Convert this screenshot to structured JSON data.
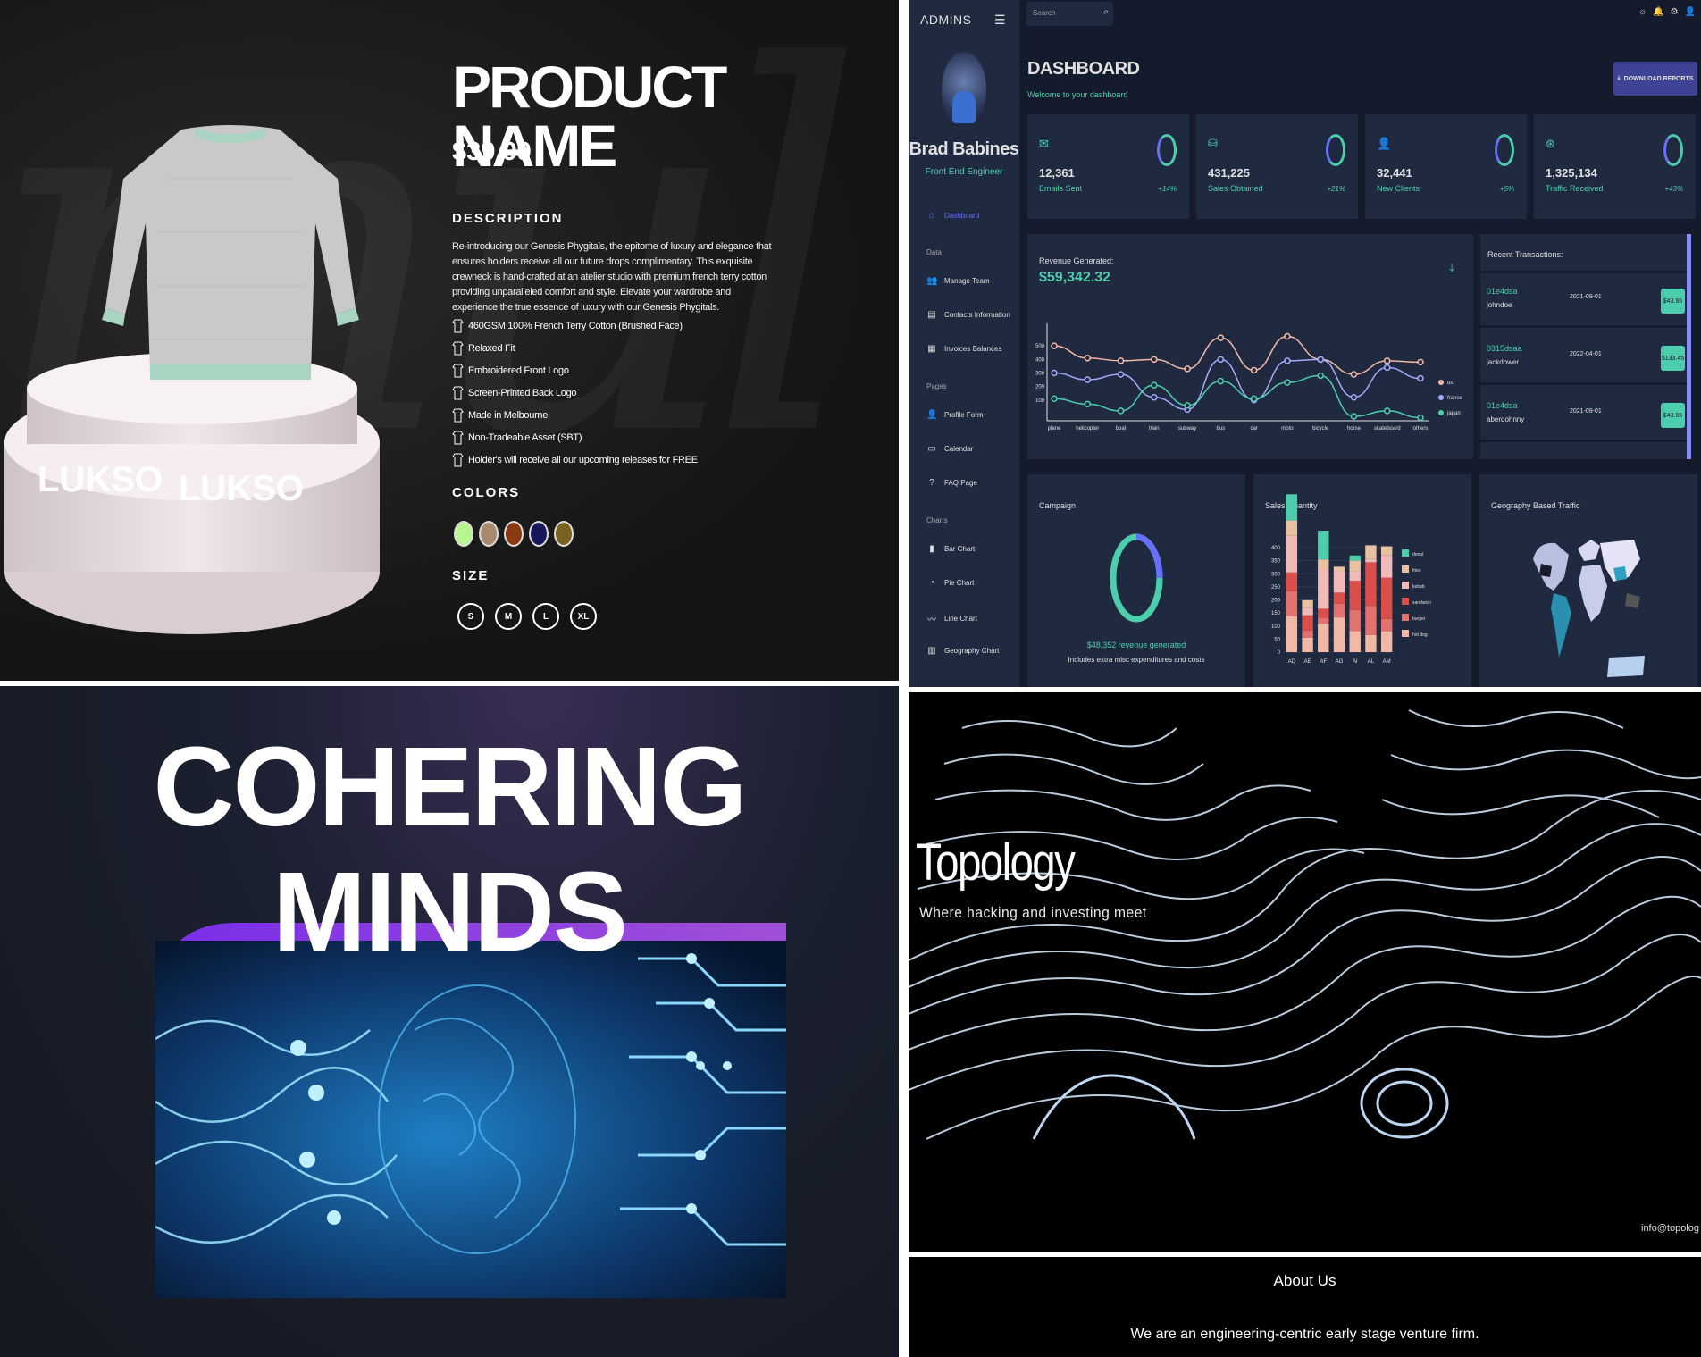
{
  "product": {
    "title": "PRODUCT NAME",
    "price": "$39.99",
    "description_label": "DESCRIPTION",
    "description": "Re-introducing our Genesis Phygitals, the epitome of luxury and elegance that ensures holders receive all our future drops complimentary. This exquisite crewneck is hand-crafted at an atelier studio with premium french terry cotton providing unparalleled comfort and style. Elevate your wardrobe and experience the true essence of luxury with our Genesis Phygitals.",
    "features": [
      "460GSM 100% French Terry Cotton (Brushed Face)",
      "Relaxed Fit",
      "Embroidered Front Logo",
      "Screen-Printed Back Logo",
      "Made in Melbourne",
      "Non-Tradeable Asset (SBT)",
      "Holder's will receive all our upcoming releases for FREE"
    ],
    "colors_label": "COLORS",
    "colors": [
      "#b7f58f",
      "#a8896e",
      "#8a3a10",
      "#17175a",
      "#7a6220"
    ],
    "size_label": "SIZE",
    "sizes": [
      "S",
      "M",
      "L",
      "XL"
    ],
    "pedestal_brand": "LUKSO"
  },
  "dashboard": {
    "brand": "ADMINS",
    "user_name": "Brad Babines",
    "user_role": "Front End Engineer",
    "nav": {
      "dashboard": "Dashboard",
      "section_data": "Data",
      "manage_team": "Manage Team",
      "contacts": "Contacts Information",
      "invoices": "Invoices Balances",
      "section_pages": "Pages",
      "profile": "Profile Form",
      "calendar": "Calendar",
      "faq": "FAQ Page",
      "section_charts": "Charts",
      "bar": "Bar Chart",
      "pie": "Pie Chart",
      "line": "Line Chart",
      "geo": "Geography Chart"
    },
    "search_placeholder": "Search",
    "title": "DASHBOARD",
    "subtitle": "Welcome to your dashboard",
    "download_label": "DOWNLOAD REPORTS",
    "stats": [
      {
        "value": "12,361",
        "label": "Emails Sent",
        "change": "+14%",
        "progress": 0.75
      },
      {
        "value": "431,225",
        "label": "Sales Obtained",
        "change": "+21%",
        "progress": 0.5
      },
      {
        "value": "32,441",
        "label": "New Clients",
        "change": "+5%",
        "progress": 0.3
      },
      {
        "value": "1,325,134",
        "label": "Traffic Received",
        "change": "+43%",
        "progress": 0.8
      }
    ],
    "revenue_label": "Revenue Generated:",
    "revenue_value": "$59,342.32",
    "transactions_label": "Recent Transactions:",
    "transactions": [
      {
        "id": "01e4dsa",
        "user": "johndoe",
        "date": "2021-09-01",
        "cost": "$43.95"
      },
      {
        "id": "0315dsaa",
        "user": "jackdower",
        "date": "2022-04-01",
        "cost": "$133.45"
      },
      {
        "id": "01e4dsa",
        "user": "aberdohnny",
        "date": "2021-09-01",
        "cost": "$43.95"
      }
    ],
    "campaign_label": "Campaign",
    "campaign_revenue": "$48,352 revenue generated",
    "campaign_note": "Includes extra misc expenditures and costs",
    "sales_label": "Sales Quantity",
    "geo_label": "Geography Based Traffic"
  },
  "chart_data": [
    {
      "type": "line",
      "categories": [
        "plane",
        "helicopter",
        "boat",
        "train",
        "subway",
        "bus",
        "car",
        "moto",
        "bicycle",
        "horse",
        "skateboard",
        "others"
      ],
      "series": [
        {
          "name": "us",
          "color": "#f2b8a6",
          "values": [
            500,
            410,
            390,
            400,
            330,
            560,
            320,
            570,
            400,
            290,
            390,
            380
          ]
        },
        {
          "name": "france",
          "color": "#a4a9fc",
          "values": [
            300,
            250,
            290,
            120,
            30,
            400,
            100,
            390,
            400,
            120,
            340,
            260
          ]
        },
        {
          "name": "japan",
          "color": "#4cceac",
          "values": [
            110,
            70,
            20,
            210,
            60,
            240,
            110,
            230,
            280,
            -20,
            20,
            -30
          ]
        }
      ],
      "yticks": [
        100,
        200,
        300,
        400,
        500
      ],
      "ylim": [
        -40,
        600
      ],
      "legend": "right"
    },
    {
      "type": "bar",
      "categories": [
        "AD",
        "AE",
        "AF",
        "AG",
        "AI",
        "AL",
        "AM"
      ],
      "series": [
        {
          "name": "hot dog",
          "color": "#f2b8a6",
          "values": [
            137,
            55,
            109,
            133,
            81,
            66,
            80
          ]
        },
        {
          "name": "burger",
          "color": "#e2726e",
          "values": [
            96,
            28,
            23,
            52,
            80,
            111,
            47
          ]
        },
        {
          "name": "sandwich",
          "color": "#db4f4a",
          "values": [
            72,
            58,
            34,
            43,
            112,
            167,
            158
          ]
        },
        {
          "name": "kebab",
          "color": "#f1b9b7",
          "values": [
            140,
            29,
            152,
            83,
            35,
            14,
            85
          ]
        },
        {
          "name": "fries",
          "color": "#e8c1a0",
          "values": [
            59,
            29,
            37,
            16,
            42,
            51,
            35
          ]
        },
        {
          "name": "donut",
          "color": "#4cceac",
          "values": [
            100,
            0,
            110,
            0,
            20,
            0,
            0
          ]
        }
      ],
      "yticks": [
        0,
        50,
        100,
        150,
        200,
        250,
        300,
        350,
        400
      ],
      "ylim": [
        0,
        400
      ],
      "legend": "right"
    }
  ],
  "cohering": {
    "title_line1": "COHERING",
    "title_line2": "MINDS"
  },
  "topology": {
    "title": "Topology",
    "tagline": "Where hacking and investing meet",
    "email": "info@topolog"
  },
  "about": {
    "heading": "About Us",
    "text": "We are an engineering-centric early stage venture firm."
  }
}
